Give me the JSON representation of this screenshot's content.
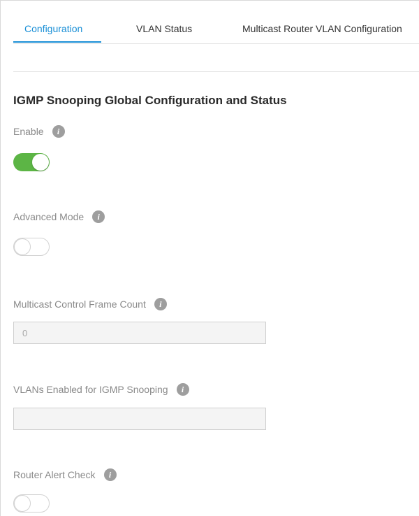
{
  "tabs": [
    {
      "label": "Configuration",
      "active": true
    },
    {
      "label": "VLAN Status",
      "active": false
    },
    {
      "label": "Multicast Router VLAN Configuration",
      "active": false
    }
  ],
  "section_title": "IGMP Snooping Global Configuration and Status",
  "fields": {
    "enable": {
      "label": "Enable",
      "state": "on"
    },
    "advanced_mode": {
      "label": "Advanced Mode",
      "state": "off"
    },
    "multicast_control_frame_count": {
      "label": "Multicast Control Frame Count",
      "value": "0"
    },
    "vlans_enabled": {
      "label": "VLANs Enabled for IGMP Snooping",
      "value": ""
    },
    "router_alert_check": {
      "label": "Router Alert Check",
      "state": "off"
    }
  },
  "info_glyph": "i",
  "colors": {
    "accent": "#1a8fd6",
    "toggle_on": "#5cb545",
    "info_icon": "#9e9e9e"
  }
}
